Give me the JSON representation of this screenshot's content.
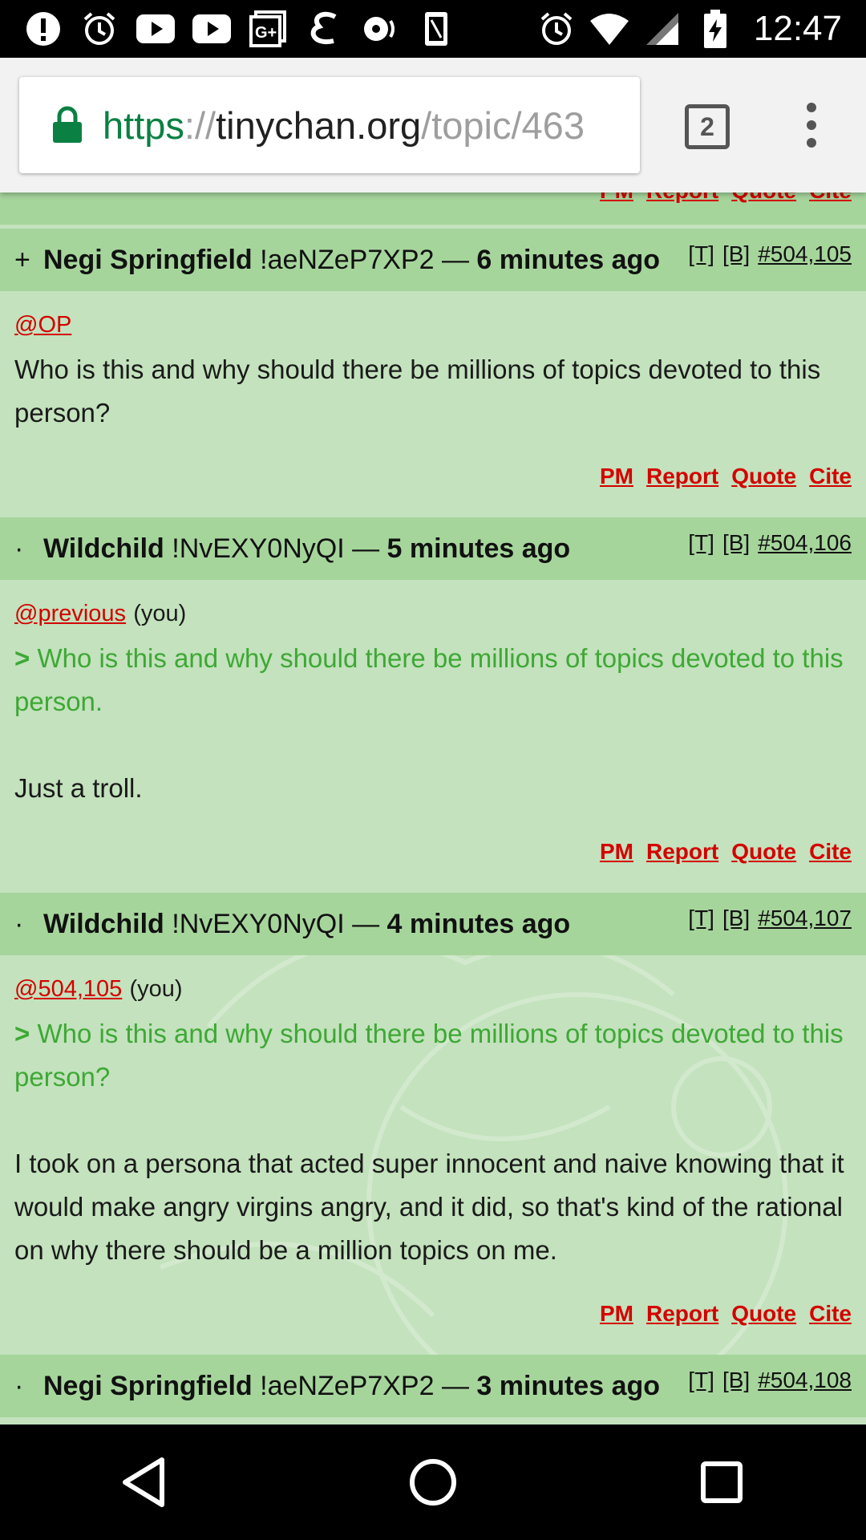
{
  "status_bar": {
    "time": "12:47",
    "left_icons": [
      "alert-icon",
      "alarm-icon",
      "youtube-icon",
      "youtube-icon",
      "google-plus-icon",
      "e-app-icon",
      "voice-icon",
      "phone-frame-icon"
    ],
    "right_icons": [
      "alarm-icon",
      "wifi-icon",
      "signal-icon",
      "battery-charging-icon"
    ]
  },
  "browser": {
    "url_scheme": "https",
    "url_sep": "://",
    "url_host": "tinychan.org",
    "url_path": "/topic/463",
    "tab_count": "2"
  },
  "cutoff_actions": {
    "pm": "PM",
    "report": "Report",
    "quote": "Quote",
    "cite": "Cite"
  },
  "posts": [
    {
      "marker": "+",
      "name": "Negi Springfield",
      "trip": "!aeNZeP7XP2",
      "dash": "—",
      "time": "6 minutes ago",
      "t_link": "[T]",
      "b_link": "[B]",
      "id": "#504,105",
      "cite": "@OP",
      "you": "",
      "quote": "",
      "body": "Who is this and why should there be millions of topics devoted to this person?",
      "actions": {
        "pm": "PM",
        "report": "Report",
        "quote": "Quote",
        "cite": "Cite"
      }
    },
    {
      "marker": "·",
      "name": "Wildchild",
      "trip": "!NvEXY0NyQI",
      "dash": "—",
      "time": "5 minutes ago",
      "t_link": "[T]",
      "b_link": "[B]",
      "id": "#504,106",
      "cite": "@previous",
      "you": "(you)",
      "quote_mark": ">",
      "quote": "Who is this and why should there be millions of topics devoted to this person.",
      "body": "Just a troll.",
      "actions": {
        "pm": "PM",
        "report": "Report",
        "quote": "Quote",
        "cite": "Cite"
      }
    },
    {
      "marker": "·",
      "name": "Wildchild",
      "trip": "!NvEXY0NyQI",
      "dash": "—",
      "time": "4 minutes ago",
      "t_link": "[T]",
      "b_link": "[B]",
      "id": "#504,107",
      "cite": "@504,105",
      "you": "(you)",
      "quote_mark": ">",
      "quote": "Who is this and why should there be millions of topics devoted to this person?",
      "body": "I took on a persona that acted super innocent and naive knowing that it would make angry virgins angry, and it did, so that's kind of the rational on why there should be a million topics on me.",
      "actions": {
        "pm": "PM",
        "report": "Report",
        "quote": "Quote",
        "cite": "Cite"
      }
    },
    {
      "marker": "·",
      "name": "Negi Springfield",
      "trip": "!aeNZeP7XP2",
      "dash": "—",
      "time": "3 minutes ago",
      "t_link": "[T]",
      "b_link": "[B]",
      "id": "#504,108"
    }
  ],
  "colors": {
    "page_bg": "#c3e2bd",
    "header_bg": "#a6d59c",
    "link_red": "#d40000",
    "quote_green": "#3ea835",
    "https_green": "#0b8043"
  },
  "nav_bar": {
    "icons": [
      "back-icon",
      "home-icon",
      "recents-icon"
    ]
  }
}
